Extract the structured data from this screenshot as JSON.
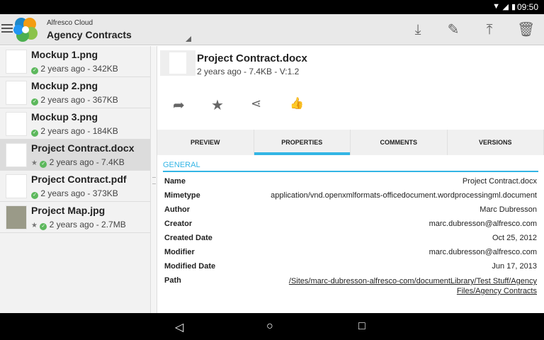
{
  "status": {
    "time": "09:50",
    "icons": [
      "wifi-icon",
      "signal-icon",
      "battery-icon"
    ]
  },
  "actionbar": {
    "subtitle": "Alfresco Cloud",
    "title": "Agency Contracts",
    "actions": [
      "download-icon",
      "edit-icon",
      "upload-icon",
      "delete-icon"
    ]
  },
  "files": [
    {
      "name": "Mockup 1.png",
      "meta": "2 years ago - 342KB",
      "favorite": false
    },
    {
      "name": "Mockup 2.png",
      "meta": "2 years ago - 367KB",
      "favorite": false
    },
    {
      "name": "Mockup 3.png",
      "meta": "2 years ago - 184KB",
      "favorite": false
    },
    {
      "name": "Project Contract.docx",
      "meta": "2 years ago - 7.4KB",
      "favorite": true
    },
    {
      "name": "Project Contract.pdf",
      "meta": "2 years ago - 373KB",
      "favorite": false
    },
    {
      "name": "Project Map.jpg",
      "meta": "2 years ago - 2.7MB",
      "favorite": true
    }
  ],
  "detail": {
    "name": "Project Contract.docx",
    "meta": "2 years ago - 7.4KB - V:1.2",
    "tabs": [
      "PREVIEW",
      "PROPERTIES",
      "COMMENTS",
      "VERSIONS"
    ],
    "section": "GENERAL",
    "props": [
      {
        "k": "Name",
        "v": "Project Contract.docx"
      },
      {
        "k": "Mimetype",
        "v": "application/vnd.openxmlformats-officedocument.wordprocessingml.document"
      },
      {
        "k": "Author",
        "v": "Marc Dubresson"
      },
      {
        "k": "Creator",
        "v": "marc.dubresson@alfresco.com"
      },
      {
        "k": "Created Date",
        "v": "Oct 25, 2012"
      },
      {
        "k": "Modifier",
        "v": "marc.dubresson@alfresco.com"
      },
      {
        "k": "Modified Date",
        "v": "Jun 17, 2013"
      },
      {
        "k": "Path",
        "v": "/Sites/marc-dubresson-alfresco-com/documentLibrary/Test Stuff/Agency Files/Agency Contracts"
      }
    ]
  },
  "colors": {
    "accent": "#33b5e5",
    "sync": "#5cb85c"
  }
}
